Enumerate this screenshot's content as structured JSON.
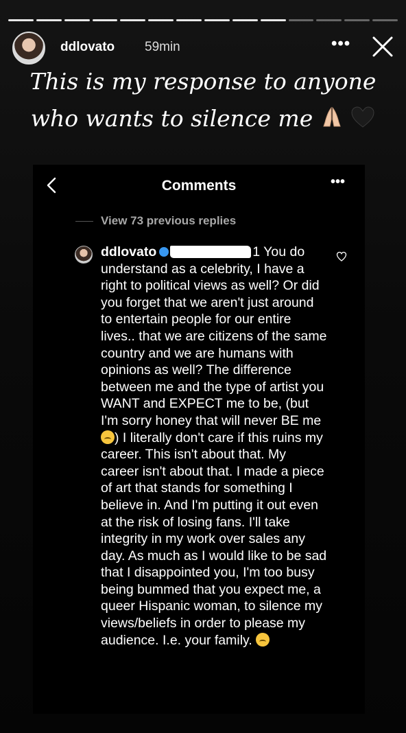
{
  "story": {
    "username": "ddlovato",
    "time": "59min",
    "more_label": "•••",
    "caption_text": "This is my response to anyone who wants to silence me",
    "caption_emojis": [
      "pray-hands-icon",
      "black-heart-icon"
    ],
    "progress_segments": 14,
    "progress_done": 10
  },
  "card": {
    "title": "Comments",
    "more_label": "•••",
    "view_previous": "View 73 previous replies",
    "comment": {
      "username": "ddlovato",
      "line1_tail": "1 You",
      "body_part1": "do understand as a celebrity, I have a right to political views as well? Or did you forget that we aren't just around to entertain people for our entire  lives.. that we are citizens of the same country and we are humans with opinions as well? The difference between me and the type of artist you WANT and EXPECT me to be, (but I'm sorry honey that will never BE me",
      "body_part2": ") I literally don't care if this ruins my career. This isn't about that. My career isn't about that. I made a piece of art that stands for something I believe in. And I'm putting it out even at the risk of losing fans. I'll take integrity in my work over sales any day. As much as I would like to be sad that I disappointed you, I'm too busy being bummed that you expect me, a queer Hispanic woman, to silence my views/beliefs in order to please my audience. I.e. your family."
    }
  },
  "colors": {
    "background": "#000000",
    "muted_text": "#a8a8a8",
    "verified_blue": "#3897f0"
  }
}
